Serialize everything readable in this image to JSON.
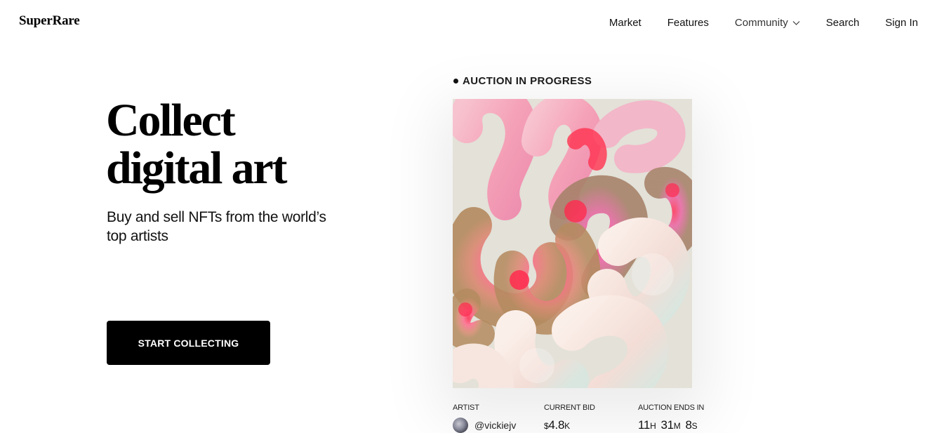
{
  "brand": {
    "logo_text": "SuperRare"
  },
  "nav": {
    "items": [
      {
        "label": "Market"
      },
      {
        "label": "Features"
      },
      {
        "label": "Community",
        "has_dropdown": true,
        "dropdown_icon": "chevron-down-icon"
      },
      {
        "label": "Search"
      },
      {
        "label": "Sign In"
      }
    ]
  },
  "hero": {
    "title_line1": "Collect",
    "title_line2": "digital art",
    "subtitle": "Buy and sell NFTs from the world’s top artists",
    "cta_label": "START COLLECTING"
  },
  "auction": {
    "status": "AUCTION IN PROGRESS",
    "artist_label": "ARTIST",
    "artist_handle": "@vickiejv",
    "bid_label": "CURRENT BID",
    "bid_currency": "$",
    "bid_amount": "4.8",
    "bid_unit": "K",
    "ends_label": "AUCTION ENDS IN",
    "hours": "11",
    "hours_unit": "H",
    "minutes": "31",
    "minutes_unit": "M",
    "seconds": "8",
    "seconds_unit": "S"
  },
  "colors": {
    "background": "#ffffff",
    "text": "#111111",
    "cta_background": "#000000",
    "cta_text": "#ffffff",
    "artwork_background": "#e3e1d8",
    "artwork_accent": "#ff2a4f"
  }
}
